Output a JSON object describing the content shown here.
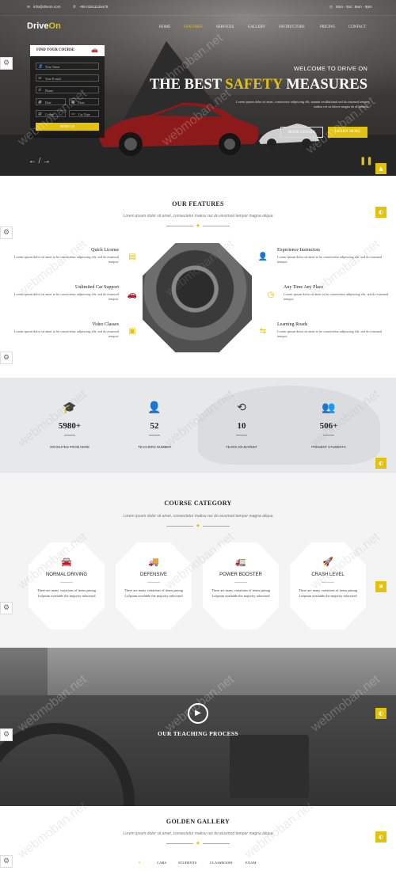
{
  "topbar": {
    "email": "info@drivon.com",
    "phone": "+88 01911125478",
    "hours": "Mon - Sat : 9am - 9pm"
  },
  "brand": {
    "logo_a": "Drive",
    "logo_b": "On"
  },
  "nav": [
    "HOME",
    "FEATURES",
    "SERVICES",
    "GALLERY",
    "INSTRUCTORS",
    "PRICING",
    "CONTACT"
  ],
  "find_course": {
    "title": "FIND YOUR COURSE",
    "fields": [
      "Your Name",
      "Your E-mail",
      "Phone",
      "Date",
      "Date",
      "Course",
      "Car Type"
    ],
    "submit": "SEND US"
  },
  "hero": {
    "subtitle": "WELCOME TO DRIVE ON",
    "title_a": "THE BEST ",
    "title_hl": "SAFETY",
    "title_b": " MEASURES",
    "text": "Lorem ipsum dolor sit amet, consectetur adipiscing elit, manim vestibulumd sed do eiusmod tempor maksu rez us labore magna do ullianmco.",
    "btn_book": "BOOK LESSON",
    "btn_learn": "LEARN MORE",
    "arrows": "← / →"
  },
  "features": {
    "title": "OUR FEATURES",
    "subtitle": "Lorem ipsum dolor sit amet, consectetur maksu rez do eiusmod tempor magna aliqua",
    "left": [
      {
        "title": "Quick License",
        "text": "Lorem ipsum dolor sit amet to be consectetur adipiscing elit, sed do eiusmod tempor."
      },
      {
        "title": "Unlimited Car Support",
        "text": "Lorem ipsum dolor sit amet to be consectetur adipiscing elit, sed do eiusmod tempor."
      },
      {
        "title": "Video Classes",
        "text": "Lorem ipsum dolor sit amet to be consectetur adipiscing elit, sed do eiusmod tempor."
      }
    ],
    "right": [
      {
        "title": "Experience Instructors",
        "text": "Lorem ipsum dolor sit amet to be consectetur adipiscing elit, sed do eiusmod tempor."
      },
      {
        "title": "Any Time Any Place",
        "text": "Lorem ipsum dolor sit amet to be consectetur adipiscing elit, sed do eiusmod tempor."
      },
      {
        "title": "Learning Roads",
        "text": "Lorem ipsum dolor sit amet to be consectetur adipiscing elit, sed do eiusmod tempor."
      }
    ]
  },
  "stats": [
    {
      "icon": "graduation-cap-icon",
      "value": "5980+",
      "label": "GRADUTED FROM HERE"
    },
    {
      "icon": "teacher-icon",
      "value": "52",
      "label": "TEACHERS NUMBER"
    },
    {
      "icon": "history-icon",
      "value": "10",
      "label": "YEARS ON MARKET"
    },
    {
      "icon": "students-icon",
      "value": "506+",
      "label": "PRESENT STUDENTS"
    }
  ],
  "courses": {
    "title": "COURSE CATEGORY",
    "subtitle": "Lorem ipsum dolor sit amet, consectetur maksu rez do eiusmod tempor magna aliqua",
    "items": [
      {
        "title": "NORMAL DRIVING",
        "text": "There are many variations of items passag Lolpsum available the majority talorsised"
      },
      {
        "title": "DEFENSIVE",
        "text": "There are many variations of items passag LoIpsum available the majority talorsised"
      },
      {
        "title": "POWER BOOSTER",
        "text": "There are many variations of items passag Lolpsum available the majority talorsised"
      },
      {
        "title": "CRASH LEVEL",
        "text": "There are many variations of items passag Lolpsum available the majority talorsised"
      }
    ]
  },
  "teaching": {
    "title": "OUR TEACHING PROCESS"
  },
  "gallery": {
    "title": "GOLDEN GALLERY",
    "subtitle": "Lorem ipsum dolor sit amet, consectetur maksu rez do eiusmod tempor magna aliqua",
    "tabs": [
      "CARS",
      "STUDENTS",
      "CLASSROOM",
      "EXAM"
    ]
  },
  "watermark": "webmoban.net",
  "colors": {
    "accent": "#e3c20f",
    "dark": "#222222"
  }
}
